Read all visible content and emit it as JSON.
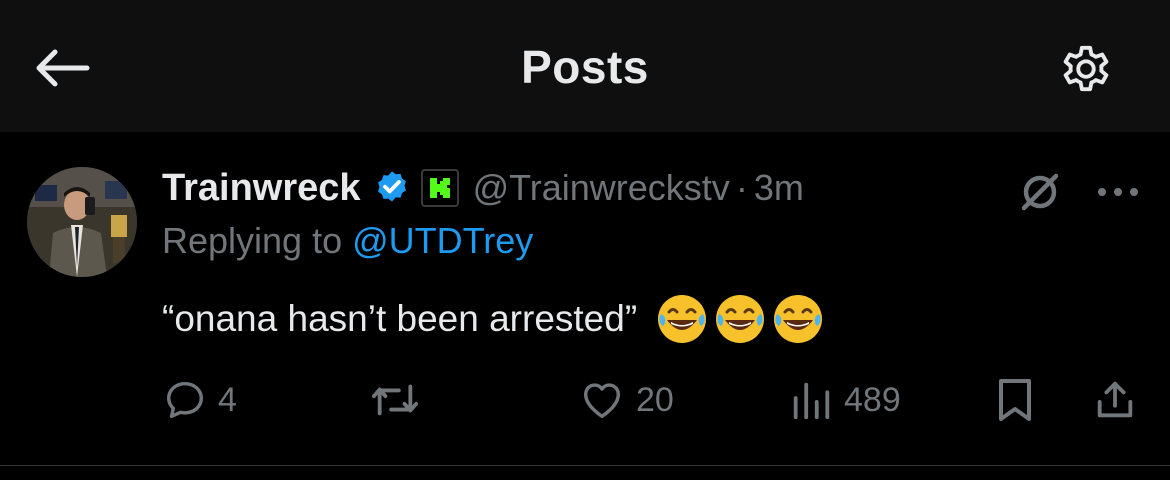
{
  "header": {
    "title": "Posts",
    "back_icon": "arrow-left-icon",
    "settings_icon": "gear-icon"
  },
  "post": {
    "author_name": "Trainwreck",
    "handle": "@Trainwreckstv",
    "separator": "·",
    "time": "3m",
    "verified_icon": "verified-badge-icon",
    "affiliate_icon": "kick-logo-icon",
    "replying_prefix": "Replying to ",
    "replying_to": "@UTDTrey",
    "text": "“onana hasn’t been arrested”",
    "emojis": [
      "😂",
      "😂",
      "😂"
    ],
    "grok_icon": "grok-icon",
    "more_icon": "more-dots-icon"
  },
  "actions": {
    "replies": "4",
    "reposts": "",
    "likes": "20",
    "views": "489"
  },
  "colors": {
    "background": "#000000",
    "header_bg": "#0f0f0f",
    "text": "#e7e9ea",
    "muted": "#71767b",
    "link": "#1d9bf0",
    "verified": "#1d9bf0",
    "kick_green": "#53fc18"
  }
}
